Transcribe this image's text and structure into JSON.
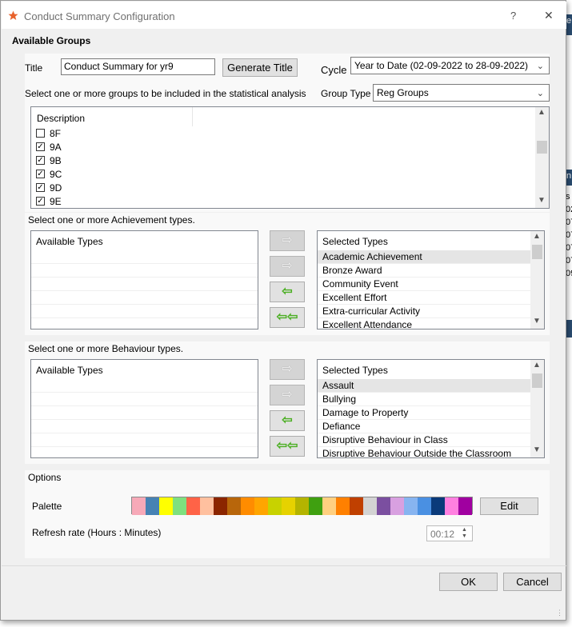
{
  "window": {
    "title": "Conduct Summary Configuration",
    "help": "?",
    "close": "✕"
  },
  "groups": {
    "heading": "Available Groups",
    "title_label": "Title",
    "title_value": "Conduct Summary for yr9",
    "generate_label": "Generate Title",
    "cycle_label": "Cycle",
    "cycle_value": "Year to Date (02-09-2022 to 28-09-2022)",
    "select_instruction": "Select one or more groups to be included in the statistical analysis",
    "group_type_label": "Group Type",
    "group_type_value": "Reg Groups",
    "column_header": "Description",
    "items": [
      {
        "label": "8F",
        "checked": false
      },
      {
        "label": "9A",
        "checked": true
      },
      {
        "label": "9B",
        "checked": true
      },
      {
        "label": "9C",
        "checked": true
      },
      {
        "label": "9D",
        "checked": true
      },
      {
        "label": "9E",
        "checked": true
      }
    ]
  },
  "achievement": {
    "instruction": "Select one or more Achievement types.",
    "available_header": "Available Types",
    "selected_header": "Selected Types",
    "selected": [
      "Academic Achievement",
      "Bronze Award",
      "Community Event",
      "Excellent Effort",
      "Extra-curricular Activity",
      "Excellent Attendance"
    ]
  },
  "behaviour": {
    "instruction": "Select one or more Behaviour types.",
    "available_header": "Available Types",
    "selected_header": "Selected Types",
    "selected": [
      "Assault",
      "Bullying",
      "Damage to Property",
      "Defiance",
      "Disruptive Behaviour in Class",
      "Disruptive Behaviour Outside the Classroom"
    ]
  },
  "options": {
    "heading": "Options",
    "palette_label": "Palette",
    "palette_colors": [
      "#f7a9b8",
      "#4682b4",
      "#ffff00",
      "#7fe07f",
      "#ff6347",
      "#ffc09f",
      "#8b2500",
      "#b8660b",
      "#ff8c00",
      "#ffa500",
      "#c8d200",
      "#e6d200",
      "#b4b400",
      "#3fa010",
      "#ffd080",
      "#ff8000",
      "#c04000",
      "#d3d3d3",
      "#7b4fa0",
      "#d8a0e0",
      "#87b4f0",
      "#4a90e2",
      "#0a3a7a",
      "#ff80e0",
      "#a000a0"
    ],
    "edit_label": "Edit",
    "refresh_label": "Refresh rate (Hours : Minutes)",
    "refresh_value": "00:12"
  },
  "footer": {
    "ok_label": "OK",
    "cancel_label": "Cancel"
  },
  "background": {
    "fragments": [
      "e",
      "s",
      "02",
      "07",
      "07",
      "07",
      "07",
      "09",
      "n"
    ]
  }
}
